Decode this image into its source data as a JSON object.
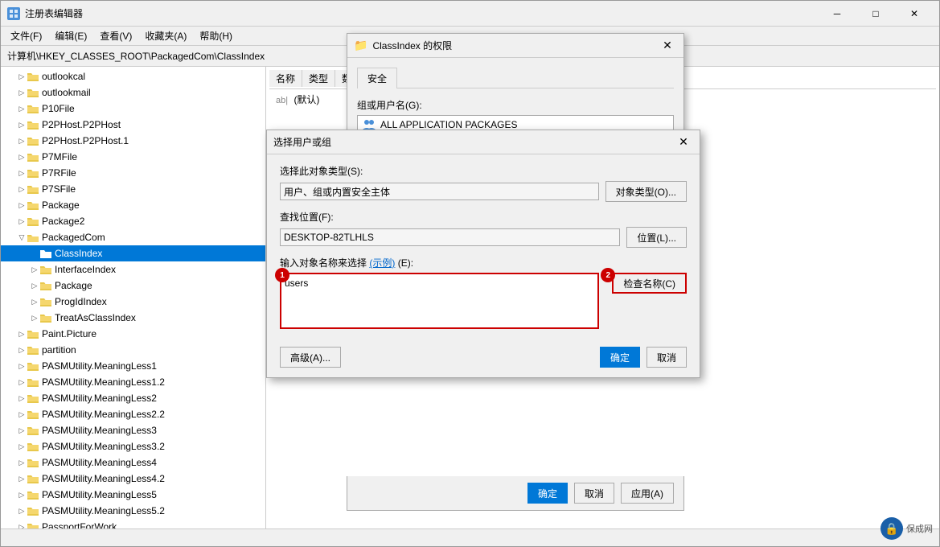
{
  "mainWindow": {
    "title": "注册表编辑器",
    "menuItems": [
      "文件(F)",
      "编辑(E)",
      "查看(V)",
      "收藏夹(A)",
      "帮助(H)"
    ],
    "addressBar": {
      "label": "计算机\\HKEY_CLASSES_ROOT\\PackagedCom\\ClassIndex"
    }
  },
  "treeItems": [
    {
      "label": "outlookcal",
      "level": 1,
      "expanded": false
    },
    {
      "label": "outlookmail",
      "level": 1,
      "expanded": false
    },
    {
      "label": "P10File",
      "level": 1,
      "expanded": false
    },
    {
      "label": "P2PHost.P2PHost",
      "level": 1,
      "expanded": false
    },
    {
      "label": "P2PHost.P2PHost.1",
      "level": 1,
      "expanded": false
    },
    {
      "label": "P7MFile",
      "level": 1,
      "expanded": false
    },
    {
      "label": "P7RFile",
      "level": 1,
      "expanded": false
    },
    {
      "label": "P7SFile",
      "level": 1,
      "expanded": false
    },
    {
      "label": "Package",
      "level": 1,
      "expanded": false
    },
    {
      "label": "Package2",
      "level": 1,
      "expanded": false
    },
    {
      "label": "PackagedCom",
      "level": 1,
      "expanded": true
    },
    {
      "label": "ClassIndex",
      "level": 2,
      "selected": true
    },
    {
      "label": "InterfaceIndex",
      "level": 2
    },
    {
      "label": "Package",
      "level": 2
    },
    {
      "label": "ProgIdIndex",
      "level": 2
    },
    {
      "label": "TreatAsClassIndex",
      "level": 2
    },
    {
      "label": "Paint.Picture",
      "level": 1
    },
    {
      "label": "partition",
      "level": 1
    },
    {
      "label": "PASMUtility.MeaningLess1",
      "level": 1
    },
    {
      "label": "PASMUtility.MeaningLess1.2",
      "level": 1
    },
    {
      "label": "PASMUtility.MeaningLess2",
      "level": 1
    },
    {
      "label": "PASMUtility.MeaningLess2.2",
      "level": 1
    },
    {
      "label": "PASMUtility.MeaningLess3",
      "level": 1
    },
    {
      "label": "PASMUtility.MeaningLess3.2",
      "level": 1
    },
    {
      "label": "PASMUtility.MeaningLess4",
      "level": 1
    },
    {
      "label": "PASMUtility.MeaningLess4.2",
      "level": 1
    },
    {
      "label": "PASMUtility.MeaningLess5",
      "level": 1
    },
    {
      "label": "PASMUtility.MeaningLess5.2",
      "level": 1
    },
    {
      "label": "PassportForWork",
      "level": 1
    }
  ],
  "rightPanel": {
    "columns": [
      "名称",
      "类型",
      "数据"
    ],
    "rows": [
      {
        "name": "(默认)",
        "type": "ab|",
        "data": ""
      }
    ]
  },
  "permissionsDialog": {
    "title": "ClassIndex 的权限",
    "tabs": [
      "安全"
    ],
    "activeTab": "安全",
    "groupLabel": "组或用户名(G):",
    "users": [
      {
        "icon": "group-icon",
        "name": "ALL APPLICATION PACKAGES"
      }
    ]
  },
  "selectUserDialog": {
    "title": "选择用户或组",
    "objectTypeLabel": "选择此对象类型(S):",
    "objectTypeValue": "用户、组或内置安全主体",
    "objectTypeBtn": "对象类型(O)...",
    "locationLabel": "查找位置(F):",
    "locationValue": "DESKTOP-82TLHLS",
    "locationBtn": "位置(L)...",
    "namesLabel": "输入对象名称来选择",
    "namesLinkText": "(示例)",
    "namesFieldLabel": "(E):",
    "namesValue": "users",
    "checkNamesBtn": "检查名称(C)",
    "advancedBtn": "高级(A)...",
    "okBtn": "确定",
    "cancelBtn": "取消",
    "badge1": "1",
    "badge2": "2"
  },
  "bottomButtons": {
    "okBtn": "确定",
    "cancelBtn": "取消",
    "applyBtn": "应用(A)"
  },
  "permissionsBottomButtons": {
    "okBtn": "确定",
    "cancelBtn": "取消"
  },
  "watermark": {
    "text": "保成网",
    "icon": "🔒"
  },
  "icons": {
    "folder": "📁",
    "group": "👥",
    "minimize": "─",
    "maximize": "□",
    "close": "✕",
    "expand": "▷",
    "collapse": "▽",
    "expandRight": "›"
  }
}
